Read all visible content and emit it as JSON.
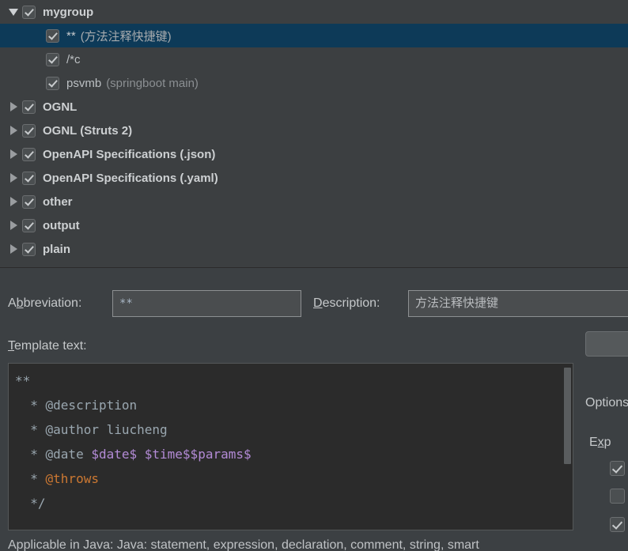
{
  "tree": {
    "rows": [
      {
        "indent": 0,
        "twisty": "expanded",
        "checked": true,
        "bold": true,
        "label": "mygroup",
        "suffix": "",
        "selected": false
      },
      {
        "indent": 1,
        "twisty": "none",
        "checked": true,
        "bold": false,
        "label": "**",
        "suffix": "(方法注释快捷键)",
        "selected": true
      },
      {
        "indent": 1,
        "twisty": "none",
        "checked": true,
        "bold": false,
        "label": "/*c",
        "suffix": "",
        "selected": false
      },
      {
        "indent": 1,
        "twisty": "none",
        "checked": true,
        "bold": false,
        "label": "psvmb",
        "suffix": "(springboot main)",
        "selected": false
      },
      {
        "indent": 0,
        "twisty": "collapsed",
        "checked": true,
        "bold": true,
        "label": "OGNL",
        "suffix": "",
        "selected": false
      },
      {
        "indent": 0,
        "twisty": "collapsed",
        "checked": true,
        "bold": true,
        "label": "OGNL (Struts 2)",
        "suffix": "",
        "selected": false
      },
      {
        "indent": 0,
        "twisty": "collapsed",
        "checked": true,
        "bold": true,
        "label": "OpenAPI Specifications (.json)",
        "suffix": "",
        "selected": false
      },
      {
        "indent": 0,
        "twisty": "collapsed",
        "checked": true,
        "bold": true,
        "label": "OpenAPI Specifications (.yaml)",
        "suffix": "",
        "selected": false
      },
      {
        "indent": 0,
        "twisty": "collapsed",
        "checked": true,
        "bold": true,
        "label": "other",
        "suffix": "",
        "selected": false
      },
      {
        "indent": 0,
        "twisty": "collapsed",
        "checked": true,
        "bold": true,
        "label": "output",
        "suffix": "",
        "selected": false
      },
      {
        "indent": 0,
        "twisty": "collapsed",
        "checked": true,
        "bold": true,
        "label": "plain",
        "suffix": "",
        "selected": false
      }
    ]
  },
  "form": {
    "abbreviation_label_pre": "A",
    "abbreviation_label_mn": "b",
    "abbreviation_label_post": "breviation:",
    "abbreviation_value": "**",
    "description_label_mn": "D",
    "description_label_post": "escription:",
    "description_value": "方法注释快捷键",
    "template_text_label_mn": "T",
    "template_text_label_post": "emplate text:"
  },
  "editor": {
    "lines": [
      [
        {
          "t": "**",
          "c": "tok-cmt"
        }
      ],
      [
        {
          "t": "  * @description",
          "c": "tok-cmt"
        }
      ],
      [
        {
          "t": "  * @author liucheng",
          "c": "tok-cmt"
        }
      ],
      [
        {
          "t": "  * @date ",
          "c": "tok-cmt"
        },
        {
          "t": "$date$ $time$$params$",
          "c": "tok-var"
        }
      ],
      [
        {
          "t": "  * ",
          "c": "tok-cmt"
        },
        {
          "t": "@throws",
          "c": "tok-tag"
        }
      ],
      [
        {
          "t": "  */",
          "c": "tok-cmt"
        }
      ]
    ]
  },
  "options": {
    "title": "Options",
    "expand_label_mn": "x",
    "expand_label_pre": "E",
    "expand_label_post": "p",
    "checkboxes": [
      true,
      false,
      true
    ]
  },
  "footer": {
    "applicable": "Applicable in Java: Java: statement, expression, declaration, comment, string, smart"
  },
  "colors": {
    "tree_bg": "#3c3f41",
    "panel_bg": "#3c4043",
    "selection_bg": "#0d3a58",
    "editor_bg": "#2b2b2b",
    "text": "#c5c8ca",
    "dim_text": "#8b8f92",
    "code_comment": "#9aa7b0",
    "code_variable": "#b38bd6",
    "code_tag": "#cc7832"
  }
}
